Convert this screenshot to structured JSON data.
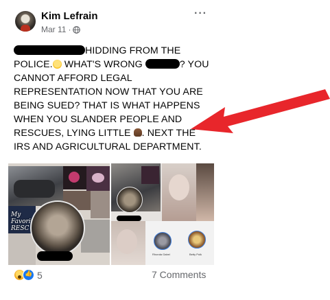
{
  "post": {
    "author": "Kim Lefrain",
    "date": "Mar 11",
    "separator": "·",
    "privacy_icon": "globe-icon",
    "more_icon": "more-options-icon",
    "more_label": "···",
    "text_lines": [
      {
        "before": "",
        "after": "HIDDING FROM THE"
      },
      {
        "before": "POLICE.",
        "middle": " WHAT'S WRONG ",
        "after": "? YOU"
      },
      {
        "text": "CANNOT AFFORD LEGAL"
      },
      {
        "text": "REPRESENTATION NOW THAT YOU ARE"
      },
      {
        "text": "BEING SUED? THAT IS WHAT HAPPENS"
      },
      {
        "text": "WHEN YOU SLANDER PEOPLE AND"
      },
      {
        "before": "RESCUES, LYING LITTLE ",
        "after": ". NEXT THE"
      },
      {
        "text": "IRS AND AGRICULTURAL DEPARTMENT."
      }
    ],
    "emojis": [
      "laughing-emoji",
      "poop-emoji"
    ],
    "photo_caption": "My Favorit RESC",
    "photo_tags": [
      "Rhonda Gabel",
      "Betty Polk"
    ]
  },
  "footer": {
    "reaction_icons": [
      "wow-reaction-icon",
      "like-reaction-icon"
    ],
    "reaction_count": "5",
    "comments": "7 Comments"
  },
  "annotation": {
    "arrow_color": "#e8262b"
  }
}
